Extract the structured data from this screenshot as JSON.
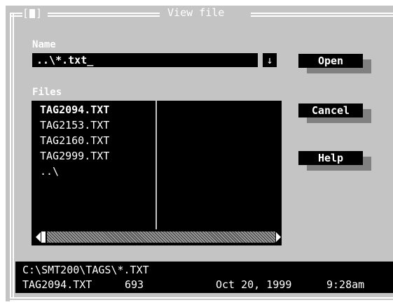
{
  "dialog": {
    "title": "View file",
    "close_open": "[",
    "close_close": "]"
  },
  "name_field": {
    "label_first": "N",
    "label_rest": "ame",
    "value": "..\\*.txt_",
    "dropdown_glyph": "↓"
  },
  "files": {
    "label_first": "F",
    "label_rest": "iles",
    "items": [
      {
        "name": "TAG2094.TXT",
        "selected": true
      },
      {
        "name": "TAG2153.TXT",
        "selected": false
      },
      {
        "name": "TAG2160.TXT",
        "selected": false
      },
      {
        "name": "TAG2999.TXT",
        "selected": false
      },
      {
        "name": "..\\",
        "selected": false
      }
    ]
  },
  "buttons": {
    "open": "Open",
    "cancel": "Cancel",
    "help": "Help"
  },
  "status": {
    "path": "C:\\SMT200\\TAGS\\*.TXT",
    "file_name": "TAG2094.TXT",
    "file_size": "693",
    "file_date": "Oct 20, 1999",
    "file_time": "9:28am"
  },
  "colors": {
    "dialog_bg": "#c4c4c4",
    "field_bg": "#000000",
    "text": "#ffffff",
    "shadow": "#808080"
  }
}
